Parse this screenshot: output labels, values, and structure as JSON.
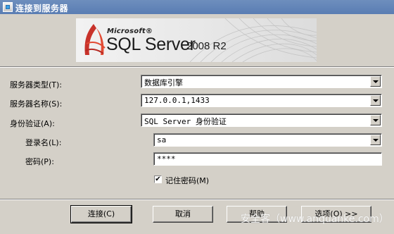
{
  "window": {
    "title": "连接到服务器",
    "app_icon": "sql-connect-icon"
  },
  "banner": {
    "microsoft_text": "Microsoft®",
    "product_text": "SQL Server",
    "version_text": "2008 R2"
  },
  "form": {
    "server_type": {
      "label": "服务器类型(T):",
      "value": "数据库引擎"
    },
    "server_name": {
      "label": "服务器名称(S):",
      "value": "127.0.0.1,1433"
    },
    "authentication": {
      "label": "身份验证(A):",
      "value": "SQL Server 身份验证"
    },
    "login": {
      "label": "登录名(L):",
      "value": "sa"
    },
    "password": {
      "label": "密码(P):",
      "value": "****"
    },
    "remember_password": {
      "label": "记住密码(M)",
      "checked": true,
      "check_mark": "✔"
    }
  },
  "buttons": {
    "connect": "连接(C)",
    "cancel": "取消",
    "help": "帮助",
    "options": "选项(O) >>"
  },
  "watermark": "安全客（www.anquanke.com）"
}
